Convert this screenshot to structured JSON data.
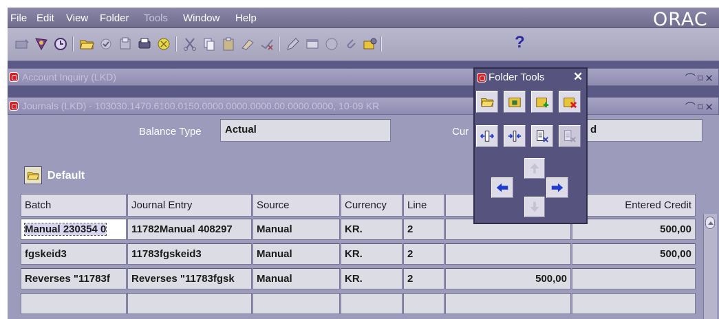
{
  "menubar": {
    "items": [
      "File",
      "Edit",
      "View",
      "Folder",
      "Tools",
      "Window",
      "Help"
    ],
    "brand": "ORAC"
  },
  "toolbar": {
    "icons": [
      "new-icon",
      "navigator-icon",
      "history-icon",
      "open-folder-icon",
      "save-icon",
      "print-icon",
      "print-setup-icon",
      "zoom-icon",
      "cut-icon",
      "copy-icon",
      "paste-icon",
      "clear-icon",
      "delete-icon",
      "edit-field-icon",
      "window-icon",
      "translations-icon",
      "attachments-icon",
      "folder-tools-icon"
    ],
    "help_label": "?"
  },
  "windows": {
    "account_inquiry_title": "Account Inquiry (LKD)",
    "journals_title": "Journals (LKD) - 103030.1470.6100.0150.0000.0000.0000.00.0000.0000, 10-09 KR"
  },
  "form": {
    "balance_type_label": "Balance Type",
    "balance_type_value": "Actual",
    "currency_label": "Cur",
    "currency_value": "d"
  },
  "folder": {
    "name": "Default"
  },
  "table": {
    "columns": [
      "Batch",
      "Journal Entry",
      "Source",
      "Currency",
      "Line",
      "",
      "Entered Credit"
    ],
    "rows": [
      [
        "Manual 230354 0",
        "11782Manual 408297",
        "Manual",
        "KR.",
        "2",
        "",
        "500,00"
      ],
      [
        "fgskeid3",
        "11783fgskeid3",
        "Manual",
        "KR.",
        "2",
        "",
        "500,00"
      ],
      [
        "Reverses \"11783f",
        "Reverses \"11783fgsk",
        "Manual",
        "KR.",
        "2",
        "500,00",
        ""
      ],
      [
        "",
        "",
        "",
        "",
        "",
        "",
        ""
      ]
    ]
  },
  "palette": {
    "title": "Folder Tools",
    "close": "✕"
  },
  "colors": {
    "desktop": "#5b5985",
    "form_bg": "#9d9bbc",
    "oracle_red": "#d91f26",
    "arrow_blue": "#1f3ccf"
  }
}
